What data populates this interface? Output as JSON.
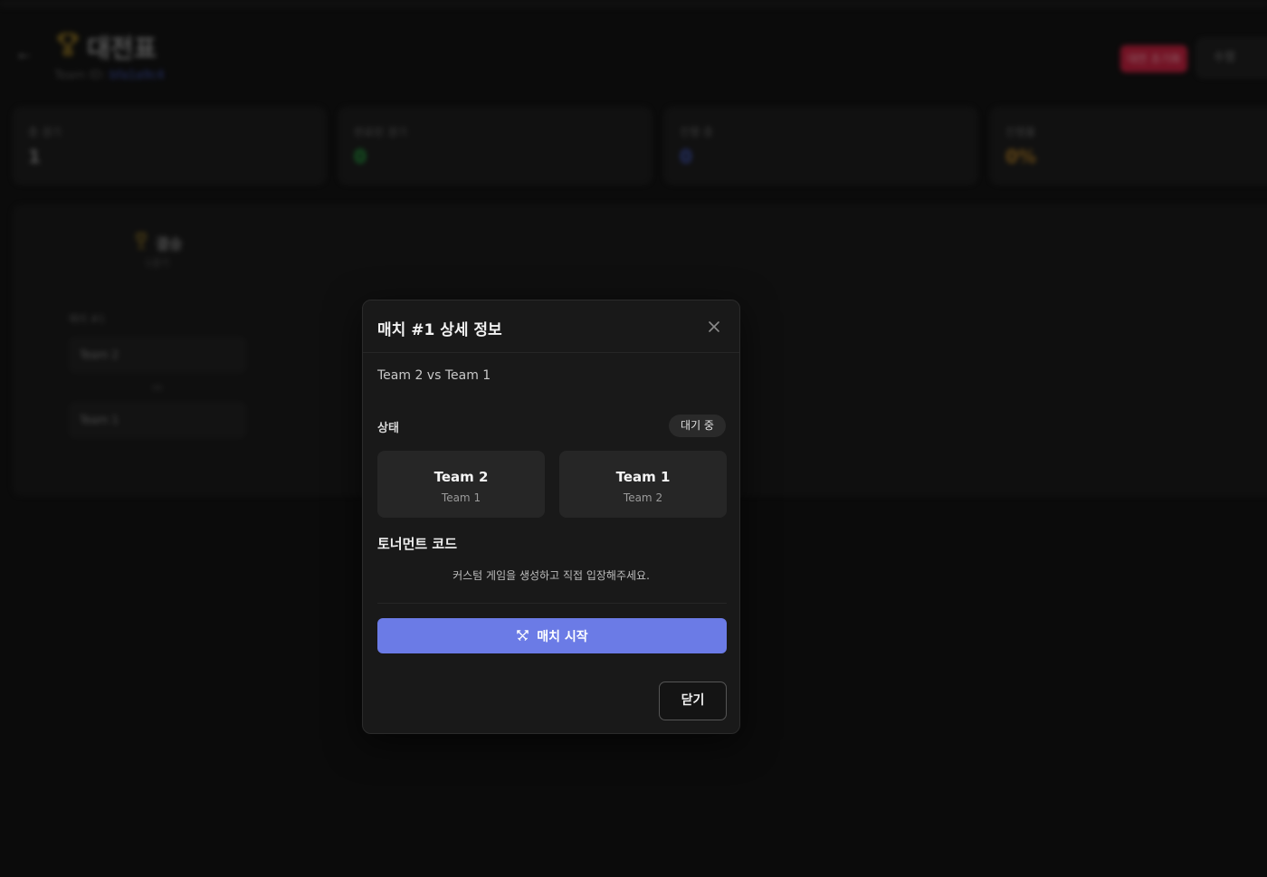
{
  "background": {
    "title": "대전표",
    "team_id_label": "Team ID:",
    "team_id_value": "bfa1a9c4",
    "reset_label": "대전 초기화",
    "edit_label": "수정",
    "stats": [
      {
        "label": "총 경기",
        "value": "1",
        "color": "#888888"
      },
      {
        "label": "완료된 경기",
        "value": "0",
        "color": "#1e9e3a"
      },
      {
        "label": "진행 중",
        "value": "0",
        "color": "#3b4fb0"
      },
      {
        "label": "진행률",
        "value": "0%",
        "color": "#b07a1e"
      }
    ],
    "final": {
      "title": "결승",
      "sub": "1경기"
    },
    "round_label": "매치 #1",
    "teams": [
      "Team 2",
      "Team 1"
    ],
    "vs": "vs"
  },
  "modal": {
    "title": "매치 #1 상세 정보",
    "matchup": "Team 2 vs Team 1",
    "status_label": "상태",
    "status_value": "대기 중",
    "team_a": {
      "name": "Team 2",
      "sub": "Team 1"
    },
    "team_b": {
      "name": "Team 1",
      "sub": "Team 2"
    },
    "code_title": "토너먼트 코드",
    "code_desc": "커스텀 게임을 생성하고 직접 입장해주세요.",
    "start_label": "매치 시작",
    "close_label": "닫기"
  },
  "colors": {
    "accent": "#6b7be6",
    "modal_bg": "#191919",
    "danger": "#c81a3a"
  }
}
